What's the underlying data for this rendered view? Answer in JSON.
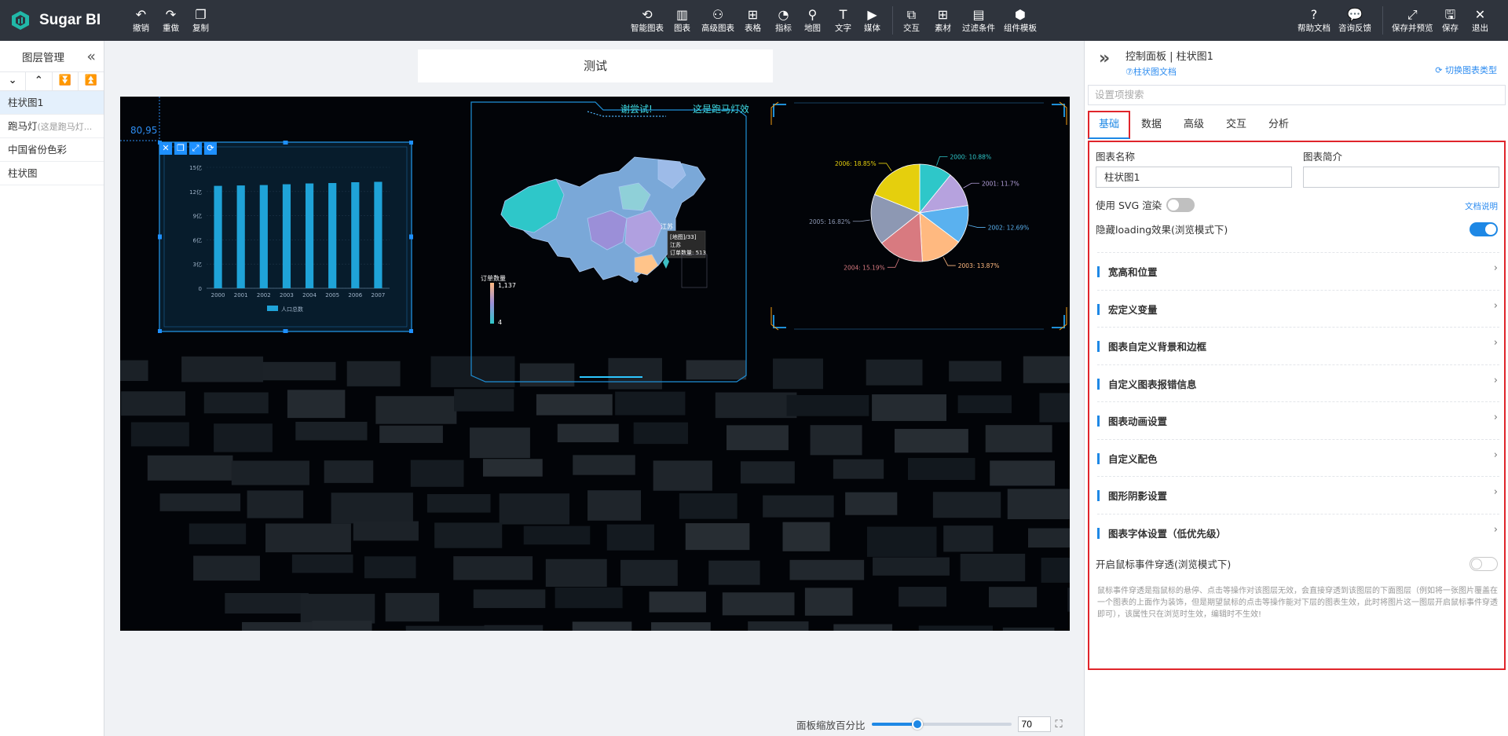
{
  "app": {
    "name": "Sugar BI"
  },
  "toolbar": {
    "left": [
      {
        "label": "撤销",
        "icon": "undo-icon",
        "glyph": "↶"
      },
      {
        "label": "重做",
        "icon": "redo-icon",
        "glyph": "↷"
      },
      {
        "label": "复制",
        "icon": "copy-icon",
        "glyph": "❐"
      }
    ],
    "center": [
      {
        "label": "智能图表",
        "icon": "smart-chart-icon",
        "glyph": "⟲"
      },
      {
        "label": "图表",
        "icon": "chart-icon",
        "glyph": "▥"
      },
      {
        "label": "高级图表",
        "icon": "advanced-chart-icon",
        "glyph": "⚇"
      },
      {
        "label": "表格",
        "icon": "table-icon",
        "glyph": "⊞"
      },
      {
        "label": "指标",
        "icon": "indicator-icon",
        "glyph": "◔"
      },
      {
        "label": "地图",
        "icon": "map-icon",
        "glyph": "⚲"
      },
      {
        "label": "文字",
        "icon": "text-icon",
        "glyph": "T"
      },
      {
        "label": "媒体",
        "icon": "media-icon",
        "glyph": "▶"
      },
      {
        "label": "交互",
        "icon": "interaction-icon",
        "glyph": "⧉"
      },
      {
        "label": "素材",
        "icon": "material-icon",
        "glyph": "⊞"
      },
      {
        "label": "过滤条件",
        "icon": "filter-icon",
        "glyph": "▤"
      },
      {
        "label": "组件模板",
        "icon": "component-template-icon",
        "glyph": "⬢"
      }
    ],
    "right": [
      {
        "label": "帮助文档",
        "icon": "help-icon",
        "glyph": "?"
      },
      {
        "label": "咨询反馈",
        "icon": "feedback-icon",
        "glyph": "💬"
      },
      {
        "label": "保存并预览",
        "icon": "save-preview-icon",
        "glyph": "⤢"
      },
      {
        "label": "保存",
        "icon": "save-icon",
        "glyph": "🖫"
      },
      {
        "label": "退出",
        "icon": "exit-icon",
        "glyph": "✕"
      }
    ]
  },
  "layers": {
    "title": "图层管理",
    "order_buttons": [
      "⌄",
      "⌃",
      "⏬",
      "⏫"
    ],
    "items": [
      {
        "label": "柱状图1",
        "sub": ""
      },
      {
        "label": "跑马灯",
        "sub": "(这是跑马灯..."
      },
      {
        "label": "中国省份色彩",
        "sub": ""
      },
      {
        "label": "柱状图",
        "sub": ""
      }
    ]
  },
  "canvas": {
    "title": "测试",
    "coord": "80,95",
    "selection_tools": [
      "✕",
      "❐",
      "⤢",
      "⟳"
    ],
    "zoom_label": "面板缩放百分比",
    "zoom_value": "70",
    "zoom_fraction": 0.33
  },
  "marquee": {
    "text1": "谢尝试!",
    "text2": "这是跑马灯效"
  },
  "chart_data": [
    {
      "type": "bar",
      "categories": [
        "2000",
        "2001",
        "2002",
        "2003",
        "2004",
        "2005",
        "2006",
        "2007"
      ],
      "series": [
        {
          "name": "人口总数",
          "values": [
            12.7,
            12.75,
            12.8,
            12.9,
            13.0,
            13.05,
            13.15,
            13.2
          ]
        }
      ],
      "y_ticks": [
        "0",
        "3亿",
        "6亿",
        "9亿",
        "12亿",
        "15亿"
      ],
      "ylim": [
        0,
        15
      ],
      "legend": "bottom",
      "colors": [
        "#1fa3d8"
      ]
    },
    {
      "type": "pie",
      "labels": [
        "2000: 10.88%",
        "2001: 11.7%",
        "2002: 12.69%",
        "2003: 13.87%",
        "2004: 15.19%",
        "2005: 16.82%",
        "2006: 18.85%"
      ],
      "values": [
        10.88,
        11.7,
        12.69,
        13.87,
        15.19,
        16.82,
        18.85
      ],
      "colors": [
        "#2ec7c9",
        "#b6a2de",
        "#5ab1ef",
        "#ffb980",
        "#d87a80",
        "#8d98b3",
        "#e5cf0d"
      ]
    }
  ],
  "map": {
    "legend_title": "订单数量",
    "legend_max": "1,137",
    "legend_min": "4",
    "city_label": "江苏",
    "tooltip_line1": "[地图]/33]",
    "tooltip_line2": "江苏",
    "tooltip_line3": "订单数量: 513"
  },
  "panel": {
    "title": "控制面板 | 柱状图1",
    "doc_link": "⑦柱状图文档",
    "switch_type": "切换图表类型",
    "search_placeholder": "设置项搜索",
    "tabs": [
      "基础",
      "数据",
      "高级",
      "交互",
      "分析"
    ],
    "chart_name_label": "图表名称",
    "chart_name_value": "柱状图1",
    "chart_desc_label": "图表简介",
    "chart_desc_value": "",
    "svg_label": "使用 SVG 渲染",
    "svg_on": false,
    "doc_explain": "文档说明",
    "loading_label": "隐藏loading效果(浏览模式下)",
    "loading_on": true,
    "sections": [
      "宽高和位置",
      "宏定义变量",
      "图表自定义背景和边框",
      "自定义图表报错信息",
      "图表动画设置",
      "自定义配色",
      "图形阴影设置",
      "图表字体设置（低优先级）"
    ],
    "mouse_label": "开启鼠标事件穿透(浏览模式下)",
    "mouse_on": false,
    "hint": "鼠标事件穿透是指鼠标的悬停、点击等操作对该图层无效，会直接穿透到该图层的下面图层（例如将一张图片覆盖在一个图表的上面作为装饰，但是期望鼠标的点击等操作能对下层的图表生效，此时将图片这一图层开启鼠标事件穿透即可），该属性只在浏览时生效，编辑时不生效!"
  }
}
